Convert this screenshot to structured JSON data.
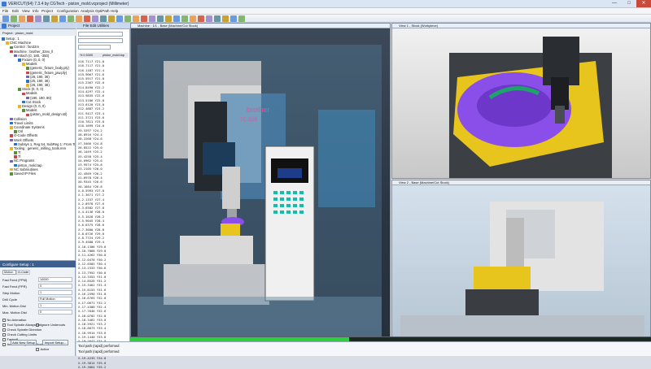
{
  "window": {
    "title": "VERICUT(64) 7.3.4 by CGTech - piston_mold.vcproject (Millimeter)",
    "controls": [
      "—",
      "□",
      "✕"
    ]
  },
  "menu": [
    "File",
    "Edit",
    "View",
    "Info",
    "Project",
    "Configuration",
    "Analysis",
    "OptiPath",
    "Help"
  ],
  "project": {
    "tab_label": "Project",
    "title": "Project : piston_mold",
    "tree": [
      "Setup : 1",
      "CNC Machine",
      "Control : fan32m",
      "Machine : brother_32ex_ll",
      "Attach (0, 180, -350)",
      "Fixture (0, 0, 0)",
      "Models",
      "(generic_fixture_body.ply)",
      "(generic_fixture_jaw.ply)",
      "(26, 190, 36)",
      "(25, 190, 36)",
      "(26, 190, 36)",
      "Stock (0, 0, 0)",
      "Models",
      "(190, 190, 80)",
      "Cut Stock",
      "Design (0, 0, 0)",
      "Models",
      "(piston_mold_design.stl)",
      "Collision",
      "Travel Limits",
      "Coordinate Systems",
      "Csl",
      "G-Code Offsets",
      "Work Offsets",
      "Subsys 1, Reg 54, SubReg 1: From Tool",
      "Tooling : generic_milling_tools.mm",
      "Tl",
      "Tl",
      "NC Programs",
      "piston_mold.tap",
      "NC Subroutines",
      "Saved IP Files"
    ]
  },
  "configure": {
    "title": "Configure Setup : 1",
    "motion_tab": "Motion",
    "gcode_tab": "G-Code",
    "fields": [
      {
        "label": "Fast Feed (FPM)",
        "value": "10000"
      },
      {
        "label": "Fast Feed (FPR)",
        "value": "0"
      },
      {
        "label": "Step Motion",
        "value": "1"
      },
      {
        "label": "Drill Cycle",
        "value": "Full Motion"
      },
      {
        "label": "Min. Motion Dist",
        "value": "1"
      },
      {
        "label": "Max. Motion Dist",
        "value": "0"
      }
    ],
    "checks": [
      "No Animation",
      "Tool Spindle Always On",
      "Check Spindle Direction",
      "Check Cutting Limits",
      "Fastmill",
      "Automatically Load Stocks",
      "Active"
    ],
    "ignore_undercuts": "Ignore Undercuts",
    "buttons": {
      "add": "Add New Setup",
      "import": "Import Setup..."
    }
  },
  "nc": {
    "title": "File  Edit  Utilities",
    "tab": "piston_mold.tap",
    "first_line": "%  0.5300",
    "lines": [
      "X16.7117 Y21.0",
      "X16.7117 Y21.0",
      "X16.1187 Y21.4",
      "X15.9067 Y21.6",
      "X15.5917 Y21.8",
      "X15.2367 Y22.0",
      "X14.8490 Y22.2",
      "X14.4297 Y22.4",
      "X13.9835 Y22.6",
      "X13.5106 Y22.8",
      "X13.0120 Y23.0",
      "X12.4887 Y23.2",
      "X11.9417 Y23.4",
      "X11.3721 Y23.6",
      "X10.7811 Y23.8",
      "X10.1699 Y24.0",
      "X9.5397 Y24.2",
      "X8.8916 Y24.4",
      "X8.2268 Y24.6",
      "X7.5466 Y24.8",
      "X6.8522 Y25.0",
      "X6.1449 Y25.2",
      "X5.4258 Y25.4",
      "X4.6962 Y25.6",
      "X3.9574 Y25.8",
      "X3.2105 Y26.0",
      "X2.4569 Y26.2",
      "X1.6978 Y26.4",
      "X0.9345 Y26.6",
      "X0.1684 Y26.8",
      "X-0.5993 Y27.0",
      "X-1.3671 Y27.2",
      "X-2.1337 Y27.4",
      "X-2.8978 Y27.6",
      "X-3.6582 Y27.8",
      "X-4.4136 Y28.0",
      "X-5.1628 Y28.2",
      "X-5.9045 Y28.4",
      "X-6.6375 Y28.6",
      "X-7.3606 Y28.8",
      "X-8.0726 Y29.0",
      "X-8.7724 Y29.2",
      "X-9.4588 Y29.4",
      "X-10.1306 Y29.6",
      "X-10.7868 Y29.8",
      "X-11.4262 Y30.0",
      "X-12.0478 Y30.2",
      "X-12.6505 Y30.4",
      "X-13.2333 Y30.6",
      "X-13.7952 Y30.8",
      "X-14.3353 Y31.0",
      "X-14.8526 Y31.2",
      "X-15.3462 Y31.4",
      "X-15.8153 Y31.6",
      "X-16.2590 Y31.8",
      "X-16.6765 Y32.0",
      "X-17.0671 Y32.2",
      "X-17.4300 Y32.4",
      "X-17.7646 Y32.6",
      "X-18.0702 Y32.8",
      "X-18.3462 Y33.0",
      "X-18.5921 Y33.2",
      "X-18.8073 Y33.4",
      "X-18.9914 Y33.6",
      "X-19.1440 Y33.8",
      "X-19.2647 Y34.0",
      "X-19.3532 Y34.2",
      "X-19.4093 Y34.4",
      "X-19.4328 Y34.6",
      "X-19.4235 Y34.8",
      "X-19.3814 Y35.0",
      "X-19.3064 Y35.2"
    ]
  },
  "viewports": {
    "v1": "Machine : 1/1 - Base (Machine/Cut Stock)",
    "v2": "View 1 - Stock (Workpiece)",
    "v3": "View 2 - Base (Machine/Cut Stock)",
    "machine_brand": "brother",
    "machine_model": "TC-S2B"
  },
  "progress": {
    "fraction": 0.42
  },
  "status": [
    "Tool path (rapid) performed",
    "Tool path (rapid) performed"
  ],
  "colors": {
    "accent": "#3d5f8f",
    "progress": "#2bd13c",
    "stock": "#e8c51d",
    "cut": "#8a4fe8"
  }
}
